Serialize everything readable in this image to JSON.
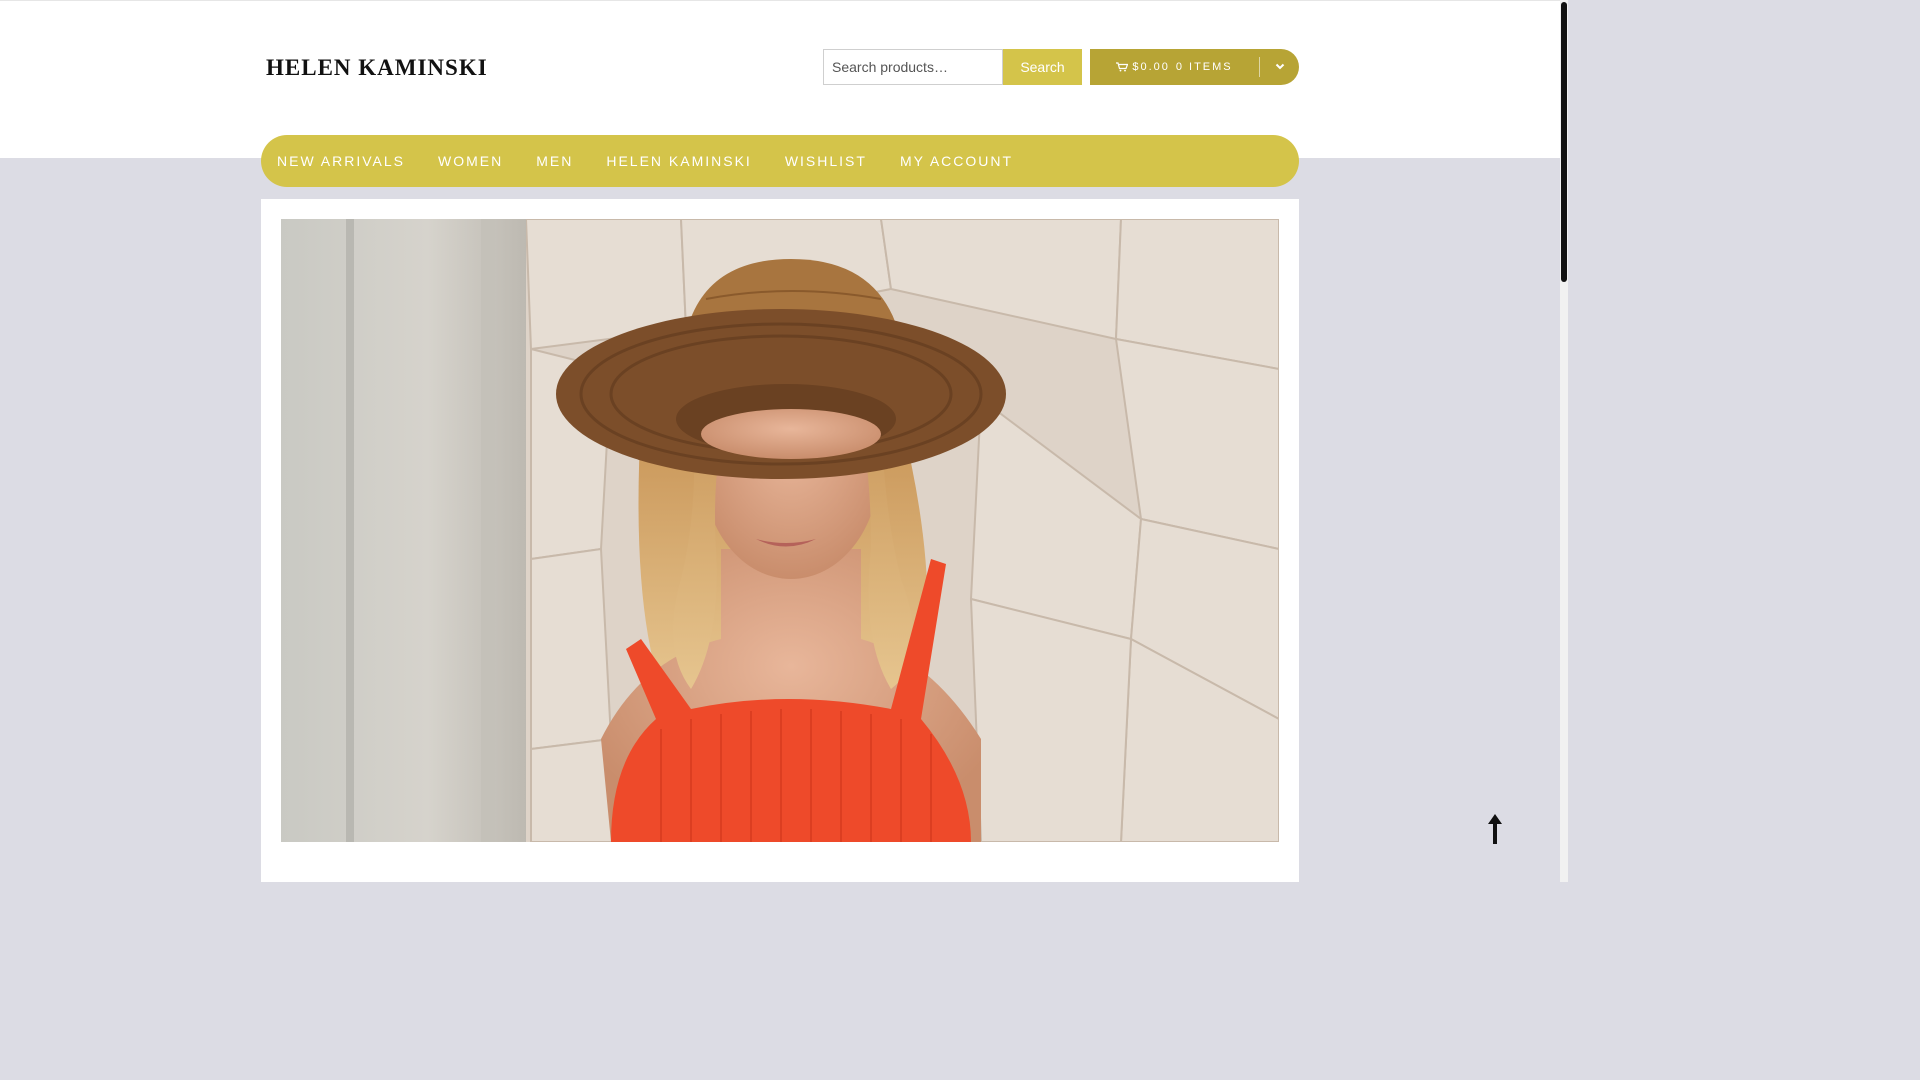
{
  "header": {
    "logo_text": "HELEN KAMINSKI",
    "search": {
      "placeholder": "Search products…",
      "button_label": "Search"
    },
    "cart": {
      "amount": "$0.00",
      "items": "0 ITEMS",
      "icon": "cart-icon",
      "toggle_icon": "chevron-down-icon"
    }
  },
  "nav": {
    "items": [
      {
        "label": "NEW ARRIVALS"
      },
      {
        "label": "WOMEN"
      },
      {
        "label": "MEN"
      },
      {
        "label": "HELEN KAMINSKI"
      },
      {
        "label": "WISHLIST"
      },
      {
        "label": "MY ACCOUNT"
      }
    ]
  },
  "hero": {
    "image": "woman-in-straw-hat-photo"
  },
  "scroll_top": {
    "icon": "arrow-up-icon"
  },
  "colors": {
    "accent": "#d4c44a",
    "cart": "#b7a435",
    "page_bg": "#dcdce4"
  }
}
